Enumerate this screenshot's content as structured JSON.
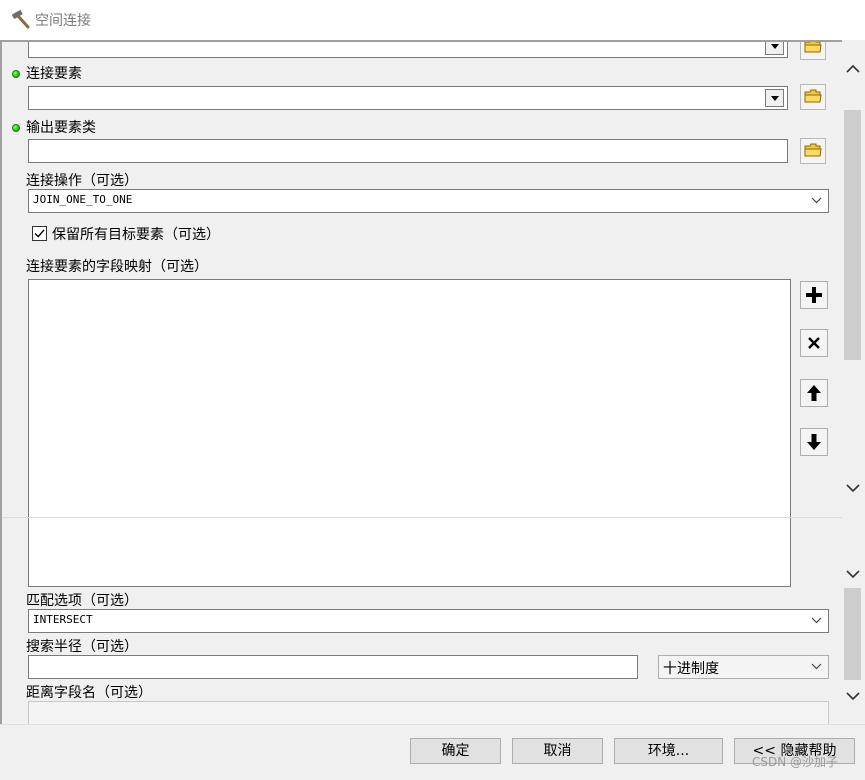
{
  "window": {
    "title": "空间连接",
    "icon": "hammer-icon"
  },
  "form": {
    "target_features": {
      "value": ""
    },
    "join_features": {
      "label": "连接要素",
      "value": ""
    },
    "output_feature_class": {
      "label": "输出要素类",
      "value": ""
    },
    "join_operation": {
      "label": "连接操作（可选）",
      "value": "JOIN_ONE_TO_ONE"
    },
    "keep_all_targets": {
      "label": "保留所有目标要素（可选）",
      "checked": true
    },
    "field_mapping": {
      "label": "连接要素的字段映射（可选）",
      "items": []
    },
    "match_option": {
      "label": "匹配选项（可选）",
      "value": "INTERSECT"
    },
    "search_radius": {
      "label": "搜索半径（可选）",
      "value": "",
      "unit": "十进制度"
    },
    "distance_field": {
      "label": "距离字段名（可选）",
      "value": ""
    }
  },
  "side_buttons": {
    "add": "plus-icon",
    "remove": "x-icon",
    "move_up": "arrow-up-icon",
    "move_down": "arrow-down-icon"
  },
  "footer": {
    "ok_label": "确定",
    "cancel_label": "取消",
    "environments_label": "环境...",
    "hide_help_label": "<< 隐藏帮助"
  },
  "watermark": "CSDN @沙加子",
  "colors": {
    "required_dot": "#18b000",
    "panel_bg": "#f0f0f0",
    "field_bg": "#ffffff"
  }
}
